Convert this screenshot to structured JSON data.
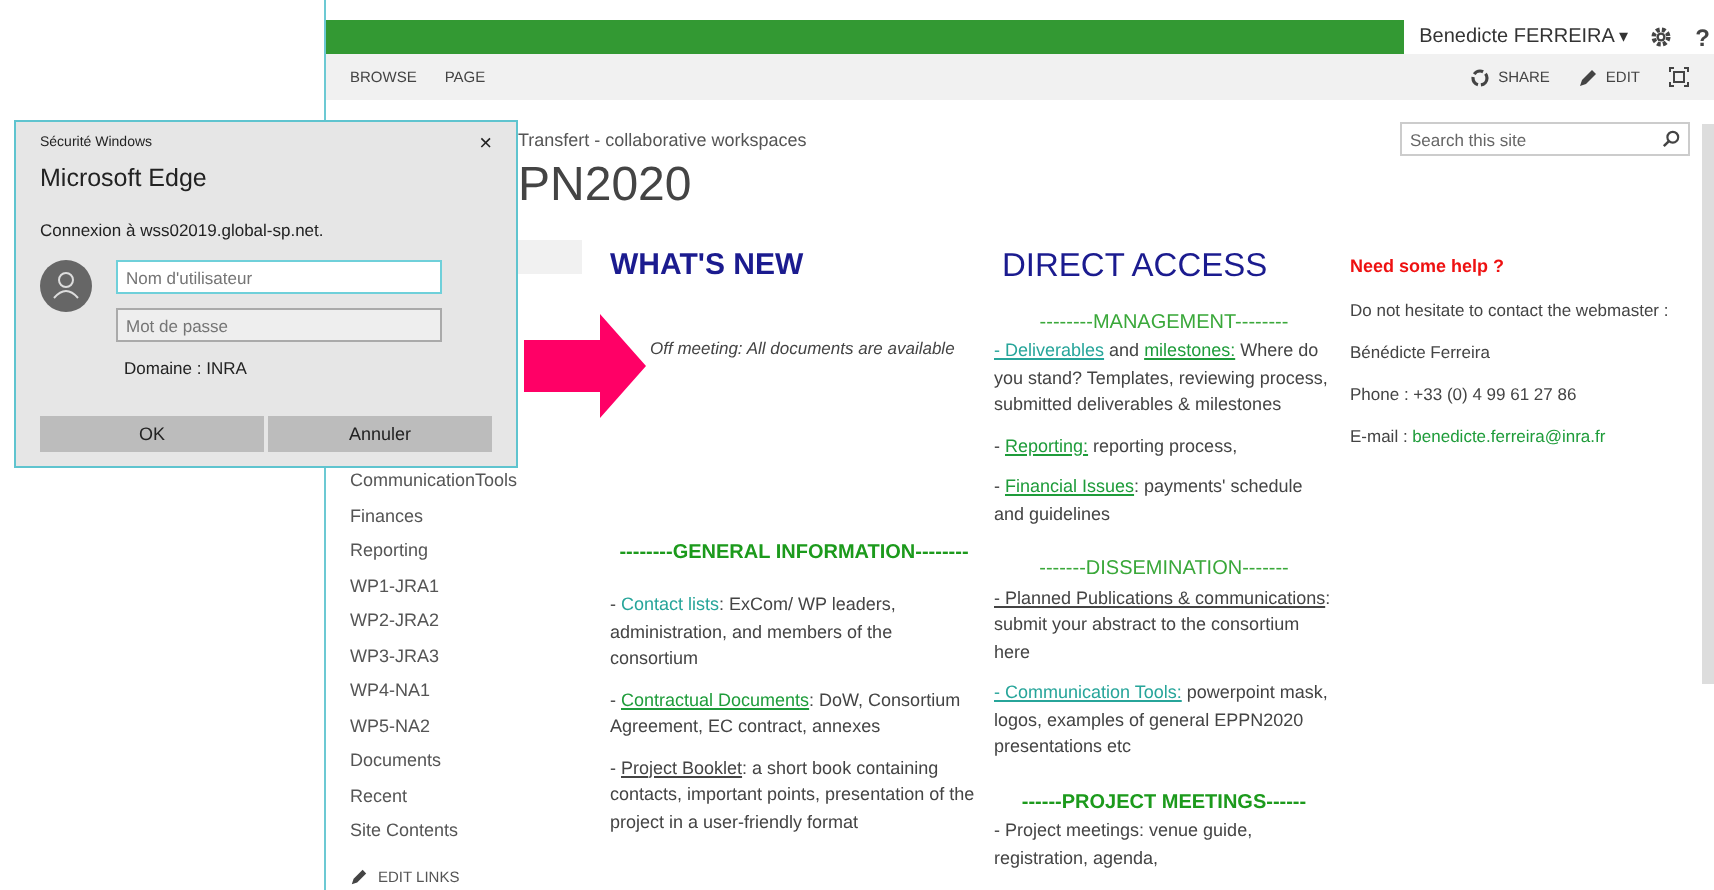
{
  "top_bar": {
    "user": "Benedicte FERREIRA",
    "caret": "▾",
    "help": "?"
  },
  "ribbon": {
    "tabs": [
      "BROWSE",
      "PAGE"
    ],
    "actions": [
      {
        "kind": "share",
        "label": "SHARE"
      },
      {
        "kind": "edit",
        "label": "EDIT"
      }
    ]
  },
  "breadcrumb": "Transfert - collaborative workspaces",
  "site_title": "PN2020",
  "search": {
    "placeholder": "Search this site"
  },
  "sidebar": {
    "items": [
      "CommunicationTools",
      "Finances",
      "Reporting",
      "WP1-JRA1",
      "WP2-JRA2",
      "WP3-JRA3",
      "WP4-NA1",
      "WP5-NA2",
      "Documents",
      "Recent",
      "Site Contents"
    ],
    "edit_links": "EDIT LINKS"
  },
  "whats_new": {
    "heading": "WHAT'S NEW",
    "news": "Off meeting: All documents are available",
    "section": {
      "title": "--------GENERAL INFORMATION--------",
      "bold": true
    },
    "paragraphs": [
      [
        {
          "kind": "text",
          "text": "- "
        },
        {
          "kind": "mention",
          "text": "Contact lists"
        },
        {
          "kind": "text",
          "text": ": ExCom/ WP leaders, administration, and members of the consortium"
        }
      ],
      [
        {
          "kind": "text",
          "text": "- "
        },
        {
          "kind": "link",
          "text": "Contractual Documents"
        },
        {
          "kind": "text",
          "text": ": DoW, Consortium Agreement, EC contract, annexes"
        }
      ],
      [
        {
          "kind": "text",
          "text": "- "
        },
        {
          "kind": "underline",
          "text": "Project Booklet"
        },
        {
          "kind": "text",
          "text": ": a short book containing contacts, important points, presentation of the project in a user-friendly format"
        }
      ]
    ]
  },
  "direct_access": {
    "heading": "DIRECT ACCESS",
    "sections": [
      {
        "title": "--------MANAGEMENT--------",
        "bold": false,
        "paragraphs": [
          [
            {
              "kind": "anchor",
              "text": "- Deliverables"
            },
            {
              "kind": "text",
              "text": " and "
            },
            {
              "kind": "link",
              "text": "milestones:"
            },
            {
              "kind": "text",
              "text": " Where do you stand? Templates, reviewing process, submitted deliverables & milestones"
            }
          ],
          [
            {
              "kind": "text",
              "text": "- "
            },
            {
              "kind": "link",
              "text": "Reporting:"
            },
            {
              "kind": "text",
              "text": " reporting process,"
            }
          ],
          [
            {
              "kind": "text",
              "text": "- "
            },
            {
              "kind": "link",
              "text": "Financial Issues"
            },
            {
              "kind": "text",
              "text": ": payments' schedule and guidelines"
            }
          ]
        ]
      },
      {
        "title": "-------DISSEMINATION-------",
        "bold": false,
        "paragraphs": [
          [
            {
              "kind": "underline",
              "text": "- Planned Publications & communications"
            },
            {
              "kind": "text",
              "text": ": submit your abstract to the consortium here"
            }
          ],
          [
            {
              "kind": "anchor",
              "text": "- Communication Tools:"
            },
            {
              "kind": "text",
              "text": "  powerpoint mask, logos, examples of general EPPN2020 presentations etc"
            }
          ]
        ]
      },
      {
        "title": "------PROJECT MEETINGS------",
        "bold": true,
        "paragraphs": [
          [
            {
              "kind": "text",
              "text": "- Project meetings: venue guide, registration, agenda,"
            }
          ]
        ]
      }
    ]
  },
  "help": {
    "title": "Need some help ?",
    "lines": [
      "Do not hesitate to contact the webmaster :",
      "Bénédicte Ferreira",
      "Phone : +33 (0) 4 99 61 27 86"
    ],
    "email_label": "E-mail : ",
    "email": "benedicte.ferreira@inra.fr"
  },
  "dialog": {
    "caption": "Sécurité Windows",
    "close": "×",
    "title": "Microsoft Edge",
    "message": "Connexion à wss02019.global-sp.net.",
    "fields": [
      {
        "placeholder": "Nom d'utilisateur",
        "focused": true
      },
      {
        "placeholder": "Mot de passe",
        "focused": false
      }
    ],
    "domain": "Domaine : INRA",
    "buttons": [
      "OK",
      "Annuler"
    ]
  }
}
